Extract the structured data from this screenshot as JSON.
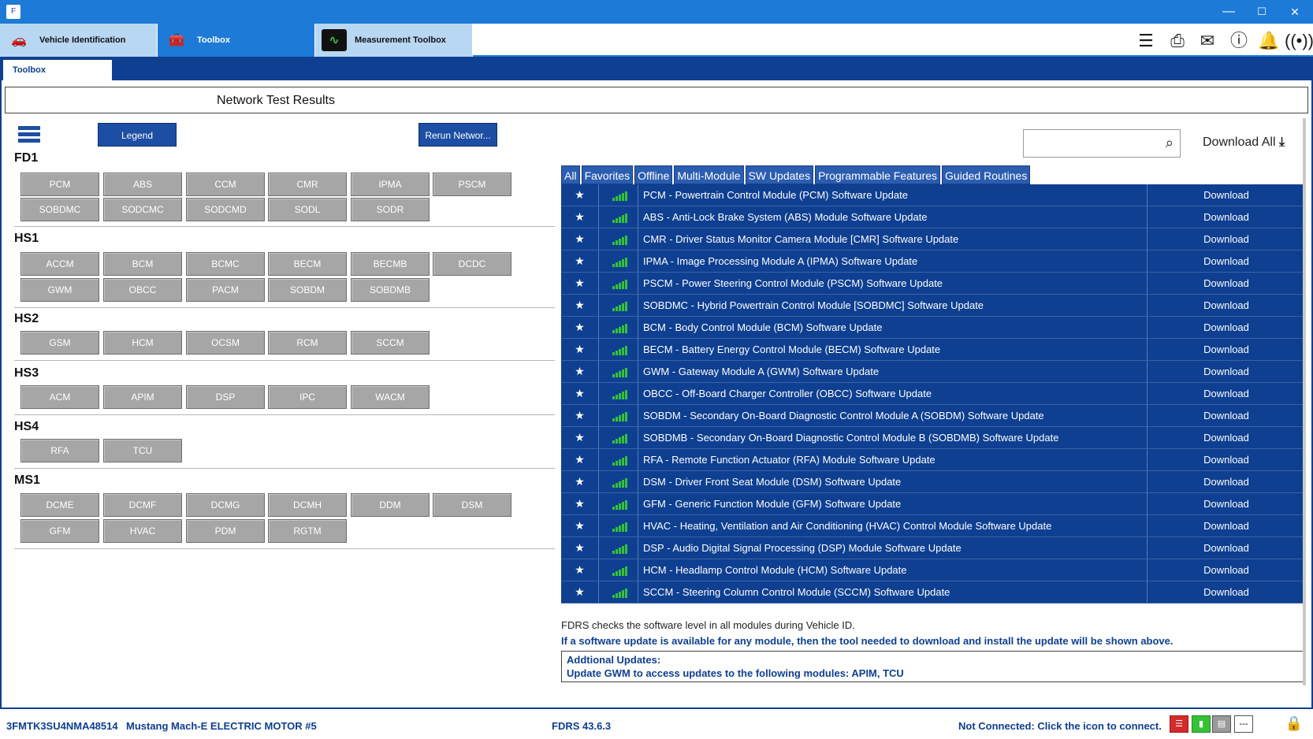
{
  "app": {
    "window_controls": {
      "minimize": "—",
      "maximize": "☐",
      "close": "✕"
    },
    "tabs": [
      {
        "label": "Vehicle Identification",
        "icon": "car-icon"
      },
      {
        "label": "Toolbox",
        "icon": "toolbox-icon"
      },
      {
        "label": "Measurement Toolbox",
        "icon": "waveform-icon"
      }
    ],
    "toolbar_icons": [
      "menu-icon",
      "printer-icon",
      "mail-icon",
      "help-icon",
      "bell-icon",
      "wireless-icon"
    ]
  },
  "inner_tab": "Toolbox",
  "page_title": "Network Test Results",
  "buttons": {
    "legend": "Legend",
    "rerun": "Rerun Networ..."
  },
  "groups": [
    {
      "label": "FD1",
      "modules": [
        "PCM",
        "ABS",
        "CCM",
        "CMR",
        "IPMA",
        "PSCM",
        "SOBDMC",
        "SODCMC",
        "SODCMD",
        "SODL",
        "SODR"
      ]
    },
    {
      "label": "HS1",
      "modules": [
        "ACCM",
        "BCM",
        "BCMC",
        "BECM",
        "BECMB",
        "DCDC",
        "GWM",
        "OBCC",
        "PACM",
        "SOBDM",
        "SOBDMB"
      ]
    },
    {
      "label": "HS2",
      "modules": [
        "GSM",
        "HCM",
        "OCSM",
        "RCM",
        "SCCM"
      ]
    },
    {
      "label": "HS3",
      "modules": [
        "ACM",
        "APIM",
        "DSP",
        "IPC",
        "WACM"
      ]
    },
    {
      "label": "HS4",
      "modules": [
        "RFA",
        "TCU"
      ]
    },
    {
      "label": "MS1",
      "modules": [
        "DCME",
        "DCMF",
        "DCMG",
        "DCMH",
        "DDM",
        "DSM",
        "GFM",
        "HVAC",
        "PDM",
        "RGTM"
      ]
    }
  ],
  "search": {
    "placeholder": ""
  },
  "download_all": "Download All",
  "filters": [
    "All",
    "Favorites",
    "Offline",
    "Multi-Module",
    "SW Updates",
    "Programmable Features",
    "Guided Routines"
  ],
  "updates": [
    "PCM - Powertrain Control Module (PCM) Software Update",
    "ABS - Anti-Lock Brake System (ABS) Module Software Update",
    "CMR - Driver Status Monitor Camera Module [CMR] Software Update",
    "IPMA - Image Processing Module A (IPMA) Software Update",
    "PSCM - Power Steering Control Module (PSCM) Software Update",
    "SOBDMC - Hybrid Powertrain Control Module [SOBDMC] Software Update",
    "BCM - Body Control Module (BCM) Software Update",
    "BECM - Battery Energy Control Module (BECM) Software Update",
    "GWM - Gateway Module A (GWM) Software Update",
    "OBCC - Off-Board Charger Controller (OBCC) Software Update",
    "SOBDM - Secondary On-Board Diagnostic Control Module A (SOBDM) Software Update",
    "SOBDMB - Secondary On-Board Diagnostic Control Module B (SOBDMB) Software Update",
    "RFA - Remote Function Actuator (RFA) Module Software Update",
    "DSM - Driver Front Seat Module (DSM) Software Update",
    "GFM - Generic Function Module (GFM) Software Update",
    "HVAC - Heating, Ventilation and Air Conditioning (HVAC) Control Module Software Update",
    "DSP - Audio Digital Signal Processing (DSP) Module Software Update",
    "HCM - Headlamp Control Module (HCM) Software Update",
    "SCCM - Steering Column Control Module (SCCM) Software Update"
  ],
  "download_label": "Download",
  "info": {
    "line1": "FDRS checks the software level in all modules during Vehicle ID.",
    "line2": "If a software update is available for any module, then the tool needed to download and install the update will be shown above.",
    "additional_title": "Addtional Updates:",
    "additional_text": "Update GWM to access updates to the following modules: APIM, TCU"
  },
  "status": {
    "vin": "3FMTK3SU4NMA48514",
    "vehicle": "Mustang Mach-E ELECTRIC MOTOR #5",
    "version": "FDRS 43.6.3",
    "connection": "Not Connected: Click the icon to connect."
  },
  "colors": {
    "accent": "#1d7ad7",
    "navy": "#0e3f91",
    "module_gray": "#a6a6a6",
    "signal_green": "#36c236"
  }
}
